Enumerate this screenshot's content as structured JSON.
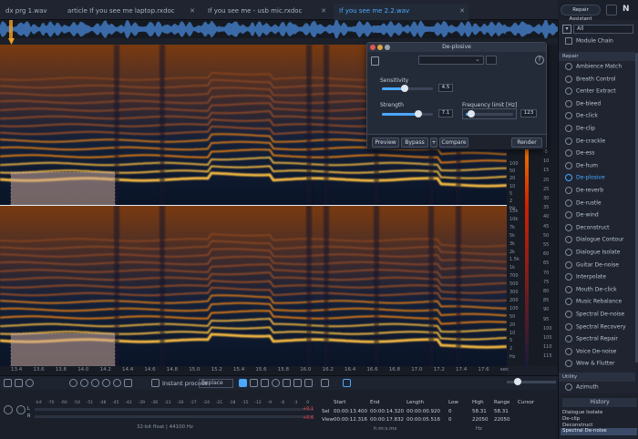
{
  "tabs": [
    {
      "label": "dx prg 1.wav",
      "active": false
    },
    {
      "label": "article If you see me laptop.rxdoc",
      "active": false
    },
    {
      "label": "If you see me - usb mic.rxdoc",
      "active": false
    },
    {
      "label": "If you see me 2.2.wav",
      "active": true
    }
  ],
  "toolbar_right": {
    "repair_assistant": "Repair Assistant"
  },
  "module_panel": {
    "filter_value": "All",
    "module_chain": "Module Chain",
    "repair_header": "Repair",
    "modules": [
      "Ambience Match",
      "Breath Control",
      "Center Extract",
      "De-bleed",
      "De-click",
      "De-clip",
      "De-crackle",
      "De-ess",
      "De-hum",
      "De-plosive",
      "De-reverb",
      "De-rustle",
      "De-wind",
      "Deconstruct",
      "Dialogue Contour",
      "Dialogue Isolate",
      "Guitar De-noise",
      "Interpolate",
      "Mouth De-click",
      "Music Rebalance",
      "Spectral De-noise",
      "Spectral Recovery",
      "Spectral Repair",
      "Voice De-noise",
      "Wow & Flutter"
    ],
    "selected_module": "De-plosive",
    "utility_header": "Utility",
    "utility_first": "Azimuth"
  },
  "history": {
    "header": "History",
    "items": [
      "Dialogue Isolate",
      "De-clip",
      "Deconstruct",
      "Spectral De-noise"
    ]
  },
  "dialog": {
    "title": "De-plosive",
    "sensitivity_label": "Sensitivity",
    "sensitivity_value": "4.5",
    "sensitivity_fraction": 0.45,
    "strength_label": "Strength",
    "strength_value": "7.1",
    "strength_fraction": 0.71,
    "freq_label": "Frequency limit [Hz]",
    "freq_value": "123",
    "freq_fraction": 0.12,
    "preview": "Preview",
    "bypass": "Bypass",
    "plus": "+",
    "compare": "Compare",
    "render": "Render"
  },
  "time_axis": [
    "13.4",
    "13.6",
    "13.8",
    "14.0",
    "14.2",
    "14.4",
    "14.6",
    "14.8",
    "15.0",
    "15.2",
    "15.4",
    "15.6",
    "15.8",
    "16.0",
    "16.2",
    "16.4",
    "16.6",
    "16.8",
    "17.0",
    "17.2",
    "17.4",
    "17.6",
    "sec"
  ],
  "freq_scale_top": [
    "100",
    "50",
    "20",
    "10",
    "5",
    "2",
    "Hz"
  ],
  "freq_scale_bottom": [
    "15k",
    "10k",
    "7k",
    "5k",
    "3k",
    "2k",
    "1.5k",
    "1k",
    "700",
    "500",
    "300",
    "200",
    "100",
    "50",
    "20",
    "10",
    "5",
    "2",
    "Hz"
  ],
  "db_scale": [
    "-5",
    "10",
    "15",
    "20",
    "25",
    "30",
    "35",
    "40",
    "45",
    "50",
    "55",
    "60",
    "65",
    "70",
    "75",
    "80",
    "85",
    "90",
    "95",
    "100",
    "105",
    "110",
    "115"
  ],
  "toolbar": {
    "instant_process": "Instant process",
    "mode": "Replace"
  },
  "meter": {
    "ticks": [
      "-Inf.",
      "-70",
      "-60",
      "-54",
      "-51",
      "-48",
      "-45",
      "-42",
      "-39",
      "-36",
      "-33",
      "-30",
      "-27",
      "-24",
      "-21",
      "-18",
      "-15",
      "-12",
      "-9",
      "-6",
      "-3",
      "0"
    ],
    "left_label": "L",
    "right_label": "R",
    "peak_l": "+0.1",
    "peak_r": "+0.6",
    "format": "32-bit float | 44100 Hz"
  },
  "selection": {
    "start_label": "Start",
    "end_label": "End",
    "length_label": "Length",
    "low_label": "Low",
    "high_label": "High",
    "range_label": "Range",
    "cursor_label": "Cursor",
    "sel_label": "Sel",
    "view_label": "View",
    "sel_start": "00:00:13.400",
    "sel_end": "00:00:14.320",
    "sel_length": "00:00:00.920",
    "view_start": "00:00:12.316",
    "view_end": "00:00:17.832",
    "view_length": "00:00:05.516",
    "sel_low": "0",
    "sel_high": "58.31",
    "sel_range": "58.31",
    "view_low": "0",
    "view_high": "22050",
    "view_range": "22050",
    "time_format": "h:m:s.ms",
    "hz_unit": "Hz"
  },
  "colors": {
    "accent": "#4aa8ff",
    "harmonic": "#ff9a1a",
    "background": "#0d1626"
  }
}
